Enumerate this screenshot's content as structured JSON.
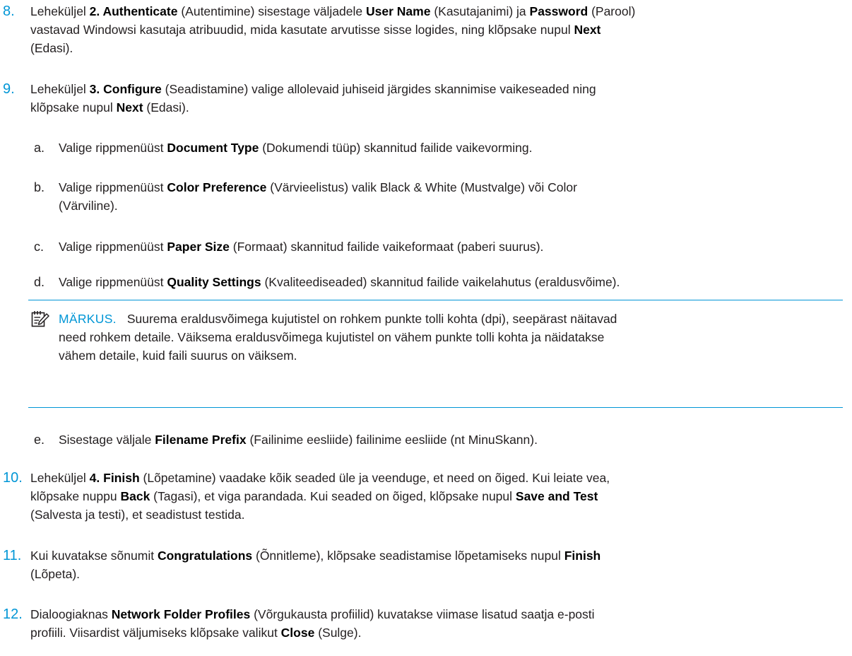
{
  "steps": {
    "s8": {
      "num": "8.",
      "t1": "Leheküljel ",
      "b1": "2. Authenticate",
      "t2": " (Autentimine) sisestage väljadele ",
      "b2": "User Name",
      "t3": " (Kasutajanimi) ja ",
      "b3": "Password",
      "t4": " (Parool)",
      "t5": "vastavad Windowsi kasutaja atribuudid, mida kasutate arvutisse sisse logides, ning klõpsake nupul ",
      "b4": "Next",
      "t6": "(Edasi)."
    },
    "s9": {
      "num": "9.",
      "t1": "Leheküljel ",
      "b1": "3. Configure",
      "t2": " (Seadistamine) valige allolevaid juhiseid järgides skannimise vaikeseaded ning",
      "t3": "klõpsake nupul ",
      "b2": "Next",
      "t4": " (Edasi)."
    },
    "a": {
      "letter": "a.",
      "t1": "Valige rippmenüüst ",
      "b1": "Document Type",
      "t2": " (Dokumendi tüüp) skannitud failide vaikevorming."
    },
    "b": {
      "letter": "b.",
      "t1": "Valige rippmenüüst ",
      "b1": "Color Preference",
      "t2": " (Värvieelistus) valik Black & White (Mustvalge) või Color",
      "t3": "(Värviline)."
    },
    "c": {
      "letter": "c.",
      "t1": "Valige rippmenüüst ",
      "b1": "Paper Size",
      "t2": " (Formaat) skannitud failide vaikeformaat (paberi suurus)."
    },
    "d": {
      "letter": "d.",
      "t1": "Valige rippmenüüst ",
      "b1": "Quality Settings",
      "t2": " (Kvaliteediseaded) skannitud failide vaikelahutus (eraldusvõime)."
    },
    "note": {
      "label": "MÄRKUS.",
      "l1": "Suurema eraldusvõimega kujutistel on rohkem punkte tolli kohta (dpi), seepärast näitavad",
      "l2": "need rohkem detaile. Väiksema eraldusvõimega kujutistel on vähem punkte tolli kohta ja näidatakse",
      "l3": "vähem detaile, kuid faili suurus on väiksem."
    },
    "e": {
      "letter": "e.",
      "t1": "Sisestage väljale ",
      "b1": "Filename Prefix",
      "t2": " (Failinime eesliide) failinime eesliide (nt MinuSkann)."
    },
    "s10": {
      "num": "10.",
      "t1": "Leheküljel ",
      "b1": "4. Finish",
      "t2": " (Lõpetamine) vaadake kõik seaded üle ja veenduge, et need on õiged. Kui leiate vea,",
      "t3": "klõpsake nuppu ",
      "b2": "Back",
      "t4": " (Tagasi), et viga parandada. Kui seaded on õiged, klõpsake nupul ",
      "b3": "Save and Test",
      "t5": "(Salvesta ja testi), et seadistust testida."
    },
    "s11": {
      "num": "11.",
      "t1": "Kui kuvatakse sõnumit ",
      "b1": "Congratulations",
      "t2": " (Õnnitleme), klõpsake seadistamise lõpetamiseks nupul ",
      "b2": "Finish",
      "t3": "(Lõpeta)."
    },
    "s12": {
      "num": "12.",
      "t1": "Dialoogiaknas ",
      "b1": "Network Folder Profiles",
      "t2": " (Võrgukausta profiilid) kuvatakse viimase lisatud saatja e-posti",
      "t3": "profiili. Viisardist väljumiseks klõpsake valikut ",
      "b2": "Close",
      "t4": " (Sulge)."
    }
  },
  "colors": {
    "accent": "#0096d6",
    "text": "#231f20"
  },
  "icons": {
    "note": "note-pencil-icon"
  }
}
